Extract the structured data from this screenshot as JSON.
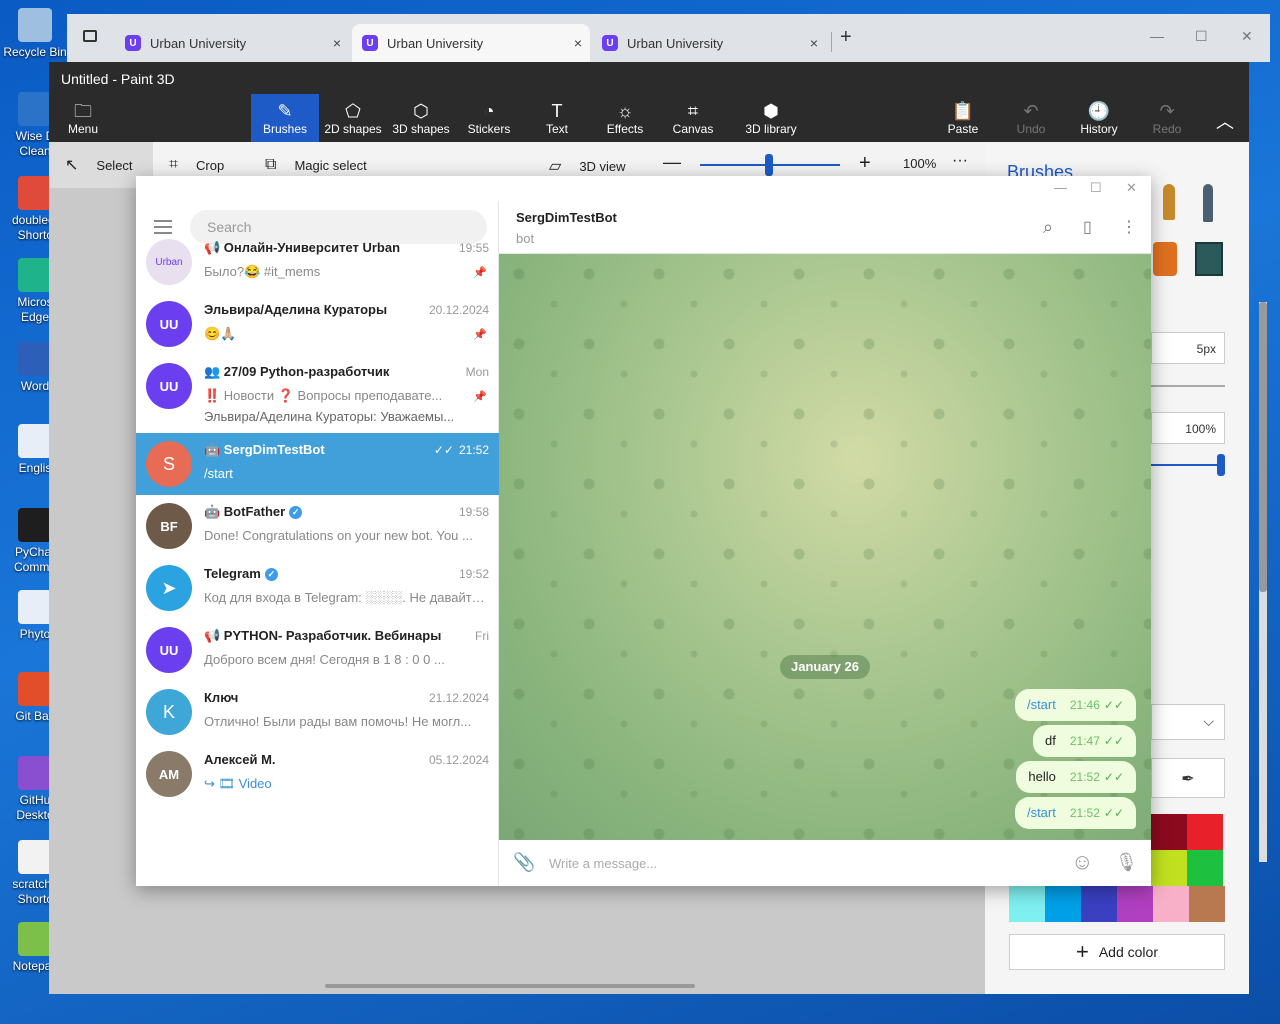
{
  "desktop": {
    "icons": [
      {
        "label": "Recycle Bin",
        "color": "#9fbfe0"
      },
      {
        "label": "Wise D\nClean",
        "color": "#2a73c9"
      },
      {
        "label": "doublecr\nShortc",
        "color": "#e04a3a"
      },
      {
        "label": "Micros\nEdge",
        "color": "#1eb38a"
      },
      {
        "label": "Word",
        "color": "#2b5fb8"
      },
      {
        "label": "Englis",
        "color": "#e8eef7"
      },
      {
        "label": "PyChar\nCommu",
        "color": "#1e1e1e"
      },
      {
        "label": "Phyto",
        "color": "#e8eef7"
      },
      {
        "label": "Git Bas",
        "color": "#e24d2a"
      },
      {
        "label": "GitHu\nDeskto",
        "color": "#8a4fd1"
      },
      {
        "label": "scratchp\nShortc",
        "color": "#f2f2f2"
      },
      {
        "label": "Notepac",
        "color": "#7cc04a"
      }
    ]
  },
  "browser": {
    "tabs": [
      {
        "label": "Urban University",
        "close": "×"
      },
      {
        "label": "Urban University",
        "close": "×"
      },
      {
        "label": "Urban University",
        "close": "×"
      }
    ],
    "new_tab": "+",
    "controls": {
      "min": "—",
      "max": "☐",
      "close": "✕"
    }
  },
  "paint": {
    "title": "Untitled - Paint 3D",
    "ribbon": [
      {
        "label": "Menu",
        "glyph": "🗀"
      },
      {
        "label": "Brushes",
        "glyph": "✎"
      },
      {
        "label": "2D shapes",
        "glyph": "⬠"
      },
      {
        "label": "3D shapes",
        "glyph": "⬡"
      },
      {
        "label": "Stickers",
        "glyph": "◔"
      },
      {
        "label": "Text",
        "glyph": "T"
      },
      {
        "label": "Effects",
        "glyph": "☼"
      },
      {
        "label": "Canvas",
        "glyph": "⌗"
      },
      {
        "label": "3D library",
        "glyph": "⬢"
      },
      {
        "label": "Paste",
        "glyph": "📋"
      },
      {
        "label": "Undo",
        "glyph": "↶"
      },
      {
        "label": "History",
        "glyph": "🕘"
      },
      {
        "label": "Redo",
        "glyph": "↷"
      }
    ],
    "subbar": {
      "select": "Select",
      "crop": "Crop",
      "magic_select": "Magic select",
      "view_3d": "3D view",
      "zoom": "100%",
      "more": "···"
    },
    "panel": {
      "title": "Brushes",
      "thickness": "5px",
      "opacity": "100%",
      "add_color": "Add color",
      "palette": [
        "#8b0a1e",
        "#e8202a",
        "#c0e020",
        "#1ec040",
        "#7ff0f0",
        "#00a0e8",
        "#3a40c0",
        "#b040c0",
        "#f8b0c8",
        "#b87850"
      ]
    }
  },
  "telegram": {
    "search_placeholder": "Search",
    "chats": [
      {
        "name": "📢 Онлайн-Университет Urban",
        "time": "19:55",
        "msg": "Было?😂 #it_mems",
        "avatar": "Urban",
        "avatar_color": "#e8e0ee"
      },
      {
        "name": "Эльвира/Аделина Кураторы",
        "time": "20.12.2024",
        "msg": "😊🙏🏼",
        "avatar": "UU",
        "avatar_color": "#6b3ff0"
      },
      {
        "name": "👥 27/09 Python-разработчик",
        "time": "Mon",
        "msg": "‼️ Новости  ❓ Вопросы преподавате...",
        "msg2": "Эльвира/Аделина Кураторы: Уважаемы...",
        "avatar": "UU",
        "avatar_color": "#6b3ff0"
      },
      {
        "name": "🤖 SergDimTestBot",
        "time": "21:52",
        "read": "✓✓",
        "msg": "/start",
        "avatar": "S",
        "avatar_color": "#e76b55"
      },
      {
        "name": "🤖 BotFather",
        "time": "19:58",
        "msg": "Done! Congratulations on your new bot. You ...",
        "avatar": "BF",
        "avatar_color": "#6d5a48"
      },
      {
        "name": "Telegram",
        "time": "19:52",
        "msg": "Код для входа в Telegram: ░░░░. Не давайте ...",
        "avatar": "➤",
        "avatar_color": "#2aa3e0"
      },
      {
        "name": "📢 PYTHON- Разработчик. Вебинары",
        "time": "Fri",
        "msg": "Доброго всем дня!  Сегодня в  1 8 : 0 0 ...",
        "avatar": "UU",
        "avatar_color": "#6b3ff0"
      },
      {
        "name": "Ключ",
        "time": "21.12.2024",
        "msg": "Отлично! Были рады вам помочь!  Не могл...",
        "avatar": "K",
        "avatar_color": "#3fa6d8"
      },
      {
        "name": "Алексей М.",
        "time": "05.12.2024",
        "msg_prefix": "↪ 🎞 ",
        "msg": "Video",
        "avatar": "АМ",
        "avatar_color": "#8a7a6a"
      }
    ],
    "active_chat": {
      "title": "SergDimTestBot",
      "subtitle": "bot",
      "date": "January 26",
      "messages": [
        {
          "text": "/start",
          "time": "21:46",
          "ticks": "✓✓",
          "command": true
        },
        {
          "text": "df",
          "time": "21:47",
          "ticks": "✓✓",
          "command": false
        },
        {
          "text": "hello",
          "time": "21:52",
          "ticks": "✓✓",
          "command": false
        },
        {
          "text": "/start",
          "time": "21:52",
          "ticks": "✓✓",
          "command": true
        }
      ],
      "composer_placeholder": "Write a message..."
    },
    "window_controls": {
      "min": "—",
      "max": "☐",
      "close": "✕"
    },
    "icons": {
      "search": "⌕",
      "sidebar": "▯",
      "more": "⋮",
      "attach": "📎",
      "emoji": "☺",
      "mic": "🎙"
    }
  }
}
